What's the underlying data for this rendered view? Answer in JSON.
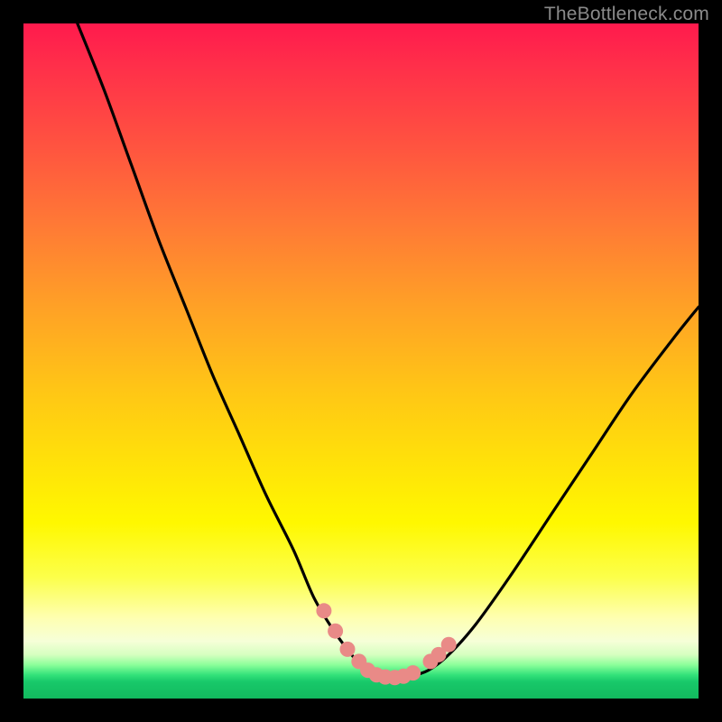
{
  "watermark": "TheBottleneck.com",
  "colors": {
    "background": "#000000",
    "curve_stroke": "#000000",
    "marker_fill": "#e98a87",
    "marker_stroke": "#c86a66",
    "gradient_top": "#ff1a4d",
    "gradient_mid": "#ffe408",
    "gradient_bottom": "#12b95e"
  },
  "chart_data": {
    "type": "line",
    "title": "",
    "xlabel": "",
    "ylabel": "",
    "xlim": [
      0,
      100
    ],
    "ylim": [
      0,
      100
    ],
    "grid": false,
    "legend": false,
    "annotations": [
      "TheBottleneck.com"
    ],
    "series": [
      {
        "name": "bottleneck-curve",
        "x": [
          8,
          12,
          16,
          20,
          24,
          28,
          32,
          36,
          40,
          43,
          46,
          49,
          51,
          53,
          55,
          57,
          60,
          63,
          67,
          72,
          78,
          84,
          90,
          96,
          100
        ],
        "y": [
          100,
          90,
          79,
          68,
          58,
          48,
          39,
          30,
          22,
          15,
          10,
          6,
          4,
          3.2,
          3,
          3.2,
          4.2,
          6.5,
          11,
          18,
          27,
          36,
          45,
          53,
          58
        ]
      }
    ],
    "markers": {
      "name": "highlight-points",
      "x": [
        44.5,
        46.2,
        48.0,
        49.7,
        51.0,
        52.3,
        53.6,
        55.0,
        56.3,
        57.7,
        60.3,
        61.5,
        63.0
      ],
      "y": [
        13.0,
        10.0,
        7.3,
        5.5,
        4.2,
        3.5,
        3.2,
        3.1,
        3.3,
        3.8,
        5.5,
        6.5,
        8.0
      ]
    }
  }
}
